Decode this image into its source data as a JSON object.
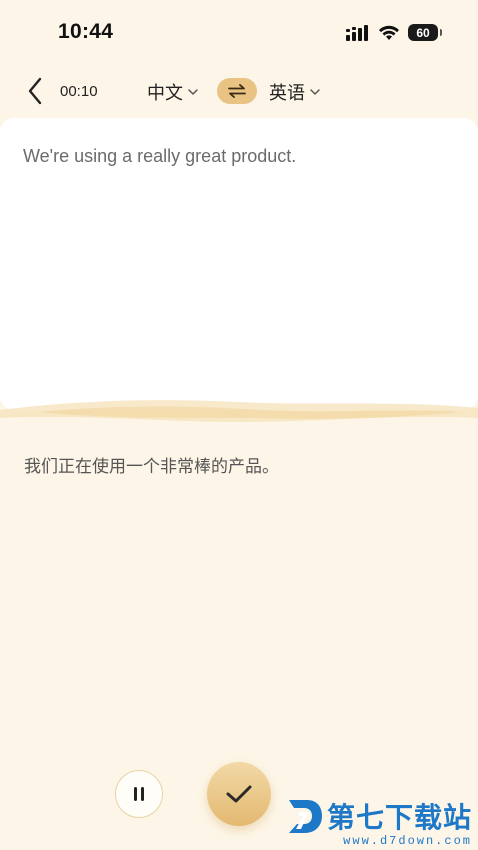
{
  "status_bar": {
    "time": "10:44",
    "battery_level": "60",
    "icons": [
      "cellular-signal-icon",
      "wifi-icon",
      "battery-icon"
    ]
  },
  "nav": {
    "timer": "00:10",
    "source_language": "中文",
    "target_language": "英语",
    "swap_icon": "swap-arrows-icon"
  },
  "translation": {
    "source_text": "We're using a really great product.",
    "target_text": "我们正在使用一个非常棒的产品。"
  },
  "controls": {
    "pause_icon": "pause-icon",
    "confirm_icon": "checkmark-icon"
  },
  "watermark": {
    "title": "第七下载站",
    "url": "www.d7down.com"
  },
  "colors": {
    "background": "#fdf6e8",
    "accent": "#e8c384",
    "brand_watermark": "#1e78c8"
  }
}
